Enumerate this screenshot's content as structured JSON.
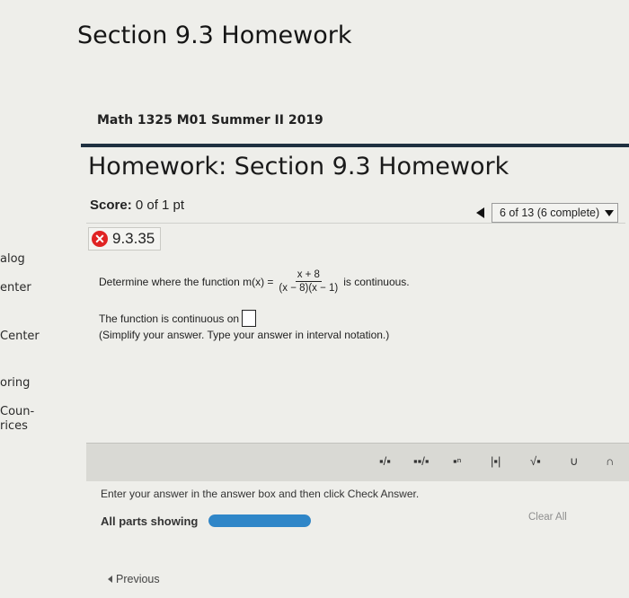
{
  "window_title": "Section 9.3 Homework",
  "course": "Math 1325 M01 Summer II 2019",
  "homework_title": "Homework: Section 9.3 Homework",
  "score": {
    "label": "Score:",
    "value": "0 of 1 pt"
  },
  "navigation": {
    "position": "6 of 13 (6 complete)"
  },
  "question": {
    "id": "9.3.35",
    "prompt_before": "Determine where the function m(x) =",
    "numerator": "x + 8",
    "denominator": "(x − 8)(x − 1)",
    "prompt_after": "is continuous.",
    "answer_label": "The function is continuous on",
    "answer_value": "",
    "hint": "(Simplify your answer. Type your answer in interval notation.)"
  },
  "sidebar": [
    {
      "label": "alog"
    },
    {
      "label": "enter"
    },
    {
      "label": "Center"
    },
    {
      "label": "oring"
    },
    {
      "label": "Coun-"
    },
    {
      "label": "rices"
    }
  ],
  "toolbar": {
    "fraction": "▪/▪",
    "mixed_number": "▪▪/▪",
    "exponent": "▪ⁿ",
    "absolute_value": "|▪|",
    "square_root": "√▪",
    "union": "∪",
    "intersection": "∩"
  },
  "instructions": "Enter your answer in the answer box and then click Check Answer.",
  "parts": {
    "label": "All parts showing",
    "progress_fraction": 1.0,
    "color": "#2f86c8"
  },
  "clear_all": "Clear All",
  "previous": "Previous"
}
